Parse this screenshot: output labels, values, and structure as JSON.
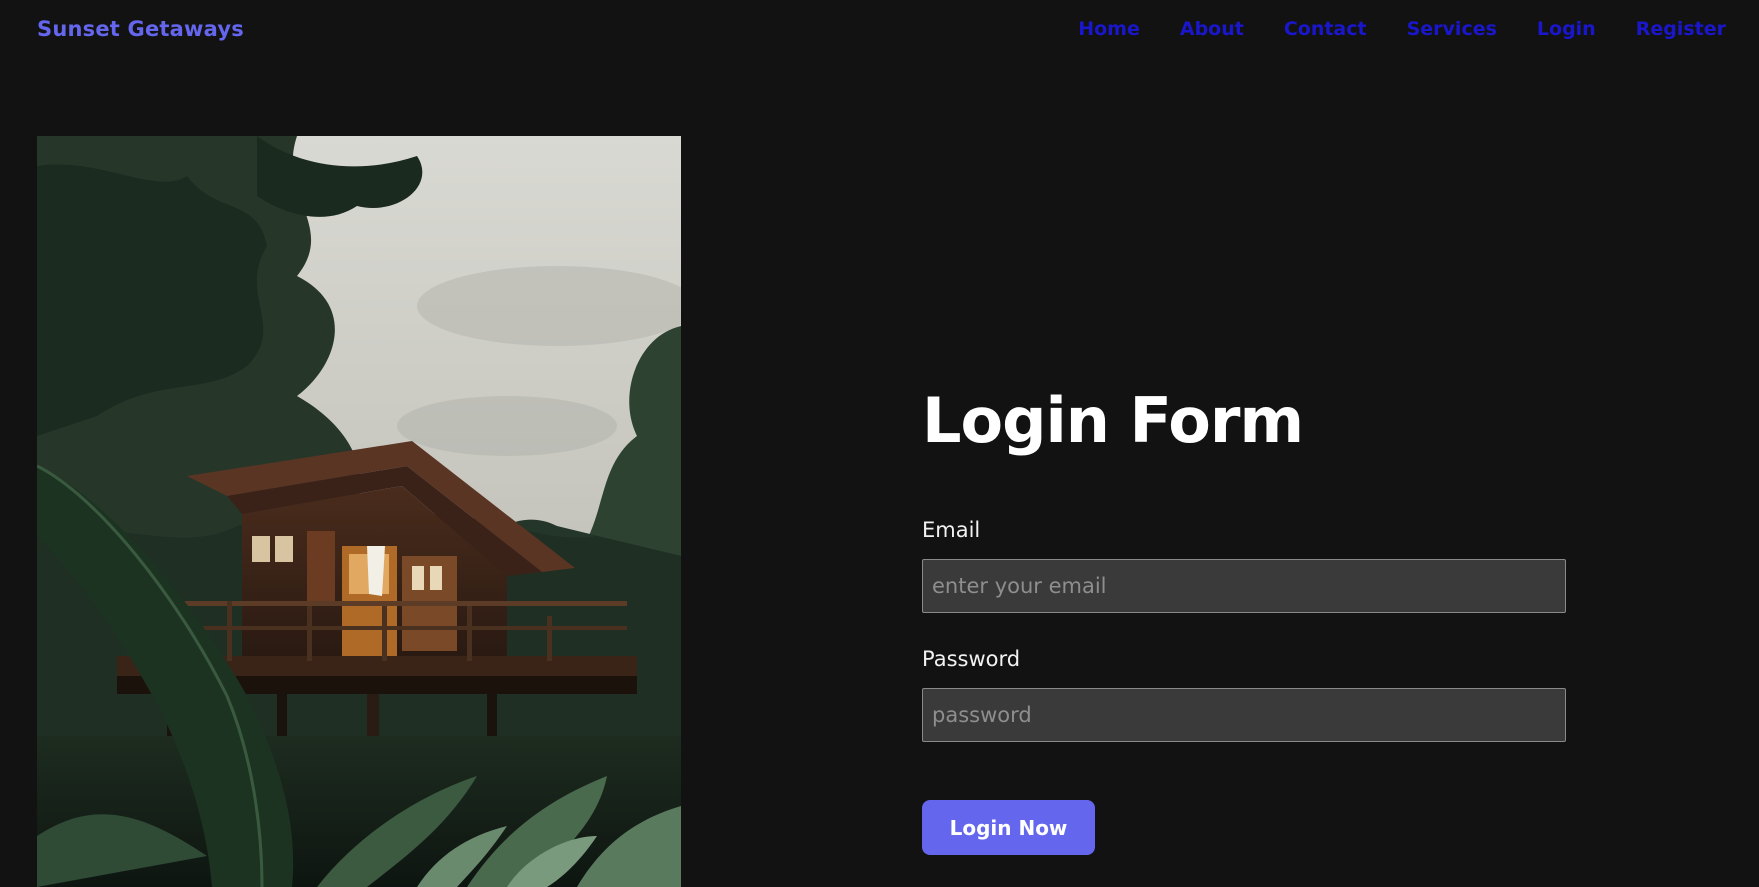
{
  "navbar": {
    "brand": "Sunset Getaways",
    "links": [
      "Home",
      "About",
      "Contact",
      "Services",
      "Login",
      "Register"
    ]
  },
  "hero_image": {
    "description": "treehouse-in-forest-photo"
  },
  "login_form": {
    "title": "Login Form",
    "email_label": "Email",
    "email_placeholder": "enter your email",
    "password_label": "Password",
    "password_placeholder": "password",
    "submit_label": "Login Now"
  },
  "colors": {
    "background": "#121212",
    "brand": "#6466ee",
    "nav_link": "#1a16cc",
    "button": "#6466ee",
    "input_bg": "#3a3a3a"
  }
}
